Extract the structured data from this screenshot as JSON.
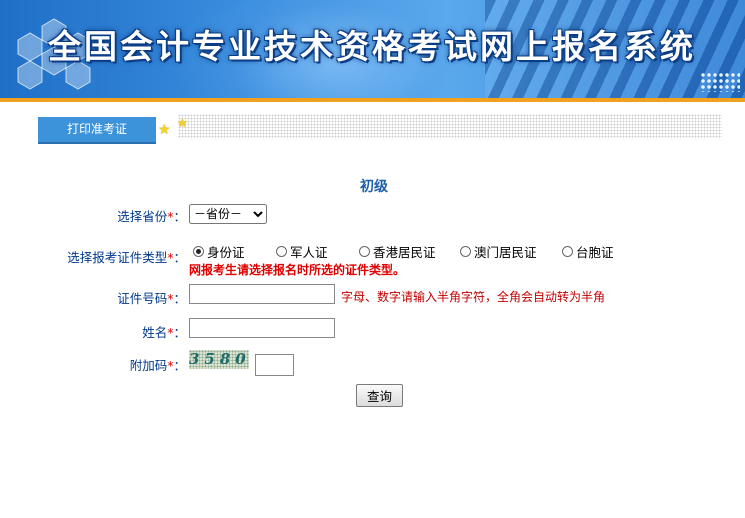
{
  "banner": {
    "title": "全国会计专业技术资格考试网上报名系统"
  },
  "tab": {
    "label": "打印准考证"
  },
  "form": {
    "level": "初级",
    "province": {
      "label": "选择省份",
      "value": "－省份－"
    },
    "idtype": {
      "label": "选择报考证件类型",
      "options": [
        "身份证",
        "军人证",
        "香港居民证",
        "澳门居民证",
        "台胞证"
      ],
      "selected_index": 0,
      "warning": "网报考生请选择报名时所选的证件类型。"
    },
    "idnumber": {
      "label": "证件号码",
      "value": "",
      "hint": "字母、数字请输入半角字符，全角会自动转为半角"
    },
    "name": {
      "label": "姓名",
      "value": ""
    },
    "captcha": {
      "label": "附加码",
      "image_text": "3580",
      "value": ""
    },
    "required_mark": "*",
    "colon": "：",
    "submit_label": "查询"
  },
  "colors": {
    "banner": "#3b8fe0",
    "stripe": "#f2a11f",
    "tab": "#3c93d9",
    "label": "#003a8c",
    "required": "#e00000"
  }
}
